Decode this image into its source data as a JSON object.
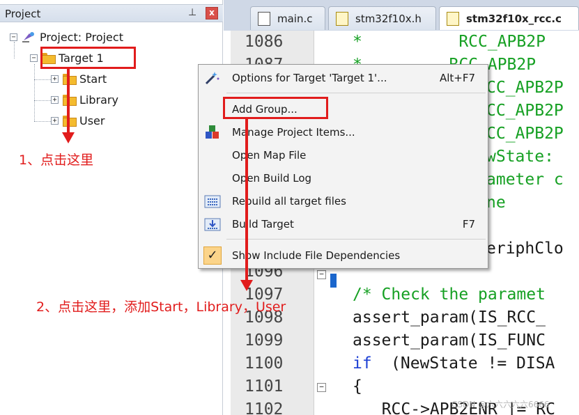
{
  "project_panel": {
    "title": "Project",
    "pin_glyph": "⊥",
    "close_glyph": "x",
    "tree": {
      "root": "Project: Project",
      "target": "Target 1",
      "groups": [
        "Start",
        "Library",
        "User"
      ]
    }
  },
  "editor": {
    "tabs": [
      {
        "label": "main.c"
      },
      {
        "label": "stm32f10x.h"
      },
      {
        "label": "stm32f10x_rcc.c",
        "active": true
      }
    ],
    "line_numbers": [
      "1086",
      "1087",
      "1096",
      "1097",
      "1098",
      "1099",
      "1100",
      "1101",
      "1102"
    ],
    "code_lines": [
      "*          RCC_APB2P",
      "*         RCC_APB2P",
      "CC_APB2P",
      "CC_APB2P",
      "CC_APB2P",
      "wState: ",
      "ameter c",
      "ne",
      "eriphClo",
      "/* Check the paramet",
      "assert_param(IS_RCC_",
      "assert_param(IS_FUNC",
      "(NewState != DISA",
      "{",
      "  RCC->APB2ENR |= RC"
    ],
    "keyword_if": "if"
  },
  "context_menu": {
    "items": [
      {
        "label": "Options for Target 'Target 1'...",
        "shortcut": "Alt+F7",
        "icon": "magic-wand-icon"
      },
      {
        "label": "Add Group...",
        "shortcut": "",
        "icon": ""
      },
      {
        "label": "Manage Project Items...",
        "shortcut": "",
        "icon": "project-items-icon"
      },
      {
        "label": "Open Map File",
        "shortcut": "",
        "icon": ""
      },
      {
        "label": "Open Build Log",
        "shortcut": "",
        "icon": ""
      },
      {
        "label": "Rebuild all target files",
        "shortcut": "",
        "icon": "rebuild-icon"
      },
      {
        "label": "Build Target",
        "shortcut": "F7",
        "icon": "build-icon"
      },
      {
        "label": "Show Include File Dependencies",
        "shortcut": "",
        "icon": "checkmark-icon"
      }
    ],
    "check_glyph": "✓"
  },
  "annotations": {
    "step1": "1、点击这里",
    "step2": "2、点击这里，添加Start，Library，User"
  },
  "watermark": "CSDN @六六六六六6666",
  "colors": {
    "annotation_red": "#e11c1c",
    "comment_green": "#16a023",
    "keyword_blue": "#1c3fd4"
  }
}
